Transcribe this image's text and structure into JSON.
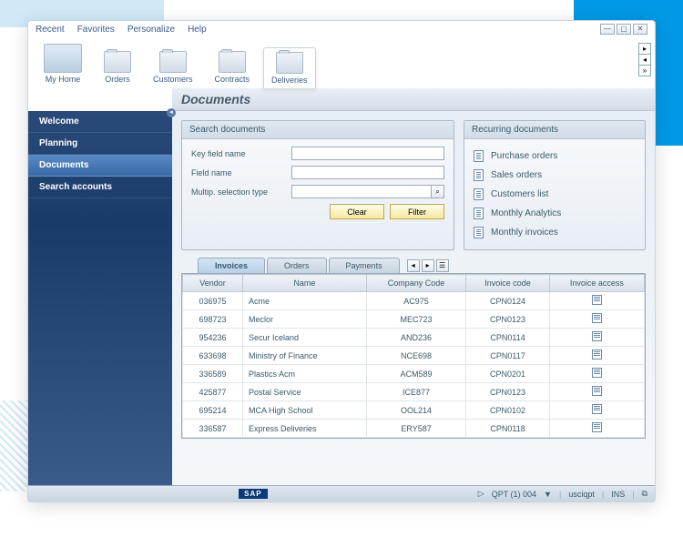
{
  "menu": {
    "recent": "Recent",
    "favorites": "Favorites",
    "personalize": "Personalize",
    "help": "Help"
  },
  "toolbar": {
    "myhome": "My Home",
    "orders": "Orders",
    "customers": "Customers",
    "contracts": "Contracts",
    "deliveries": "Deliveries"
  },
  "page_title": "Documents",
  "sidebar": {
    "items": [
      {
        "label": "Welcome"
      },
      {
        "label": "Planning"
      },
      {
        "label": "Documents"
      },
      {
        "label": "Search accounts"
      }
    ],
    "active_index": 2
  },
  "search": {
    "header": "Search documents",
    "key_field_label": "Key field name",
    "field_label": "Field name",
    "multip_label": "Multip. selection type",
    "key_field_value": "",
    "field_value": "",
    "multip_value": "",
    "clear": "Clear",
    "filter": "Filter"
  },
  "recurring": {
    "header": "Recurring documents",
    "items": [
      {
        "label": "Purchase orders"
      },
      {
        "label": "Sales orders"
      },
      {
        "label": "Customers list"
      },
      {
        "label": "Monthly Analytics"
      },
      {
        "label": "Monthly invoices"
      }
    ]
  },
  "tabs": {
    "items": [
      "Invoices",
      "Orders",
      "Payments"
    ],
    "active_index": 0
  },
  "table": {
    "columns": [
      "Vendor",
      "Name",
      "Company Code",
      "Invoice code",
      "Invoice access"
    ],
    "rows": [
      {
        "vendor": "036975",
        "name": "Acme",
        "company": "AC975",
        "invoice": "CPN0124"
      },
      {
        "vendor": "698723",
        "name": "Meclor",
        "company": "MEC723",
        "invoice": "CPN0123"
      },
      {
        "vendor": "954236",
        "name": "Secur Iceland",
        "company": "AND236",
        "invoice": "CPN0114"
      },
      {
        "vendor": "633698",
        "name": "Ministry of Finance",
        "company": "NCE698",
        "invoice": "CPN0117"
      },
      {
        "vendor": "336589",
        "name": "Plastics Acm",
        "company": "ACM589",
        "invoice": "CPN0201"
      },
      {
        "vendor": "425877",
        "name": "Postal Service",
        "company": "ICE877",
        "invoice": "CPN0123"
      },
      {
        "vendor": "695214",
        "name": "MCA High School",
        "company": "OOL214",
        "invoice": "CPN0102"
      },
      {
        "vendor": "336587",
        "name": "Express Deliveries",
        "company": "ERY587",
        "invoice": "CPN0118"
      }
    ]
  },
  "status": {
    "logo": "SAP",
    "system": "QPT (1) 004",
    "client": "usciqpt",
    "mode": "INS"
  }
}
